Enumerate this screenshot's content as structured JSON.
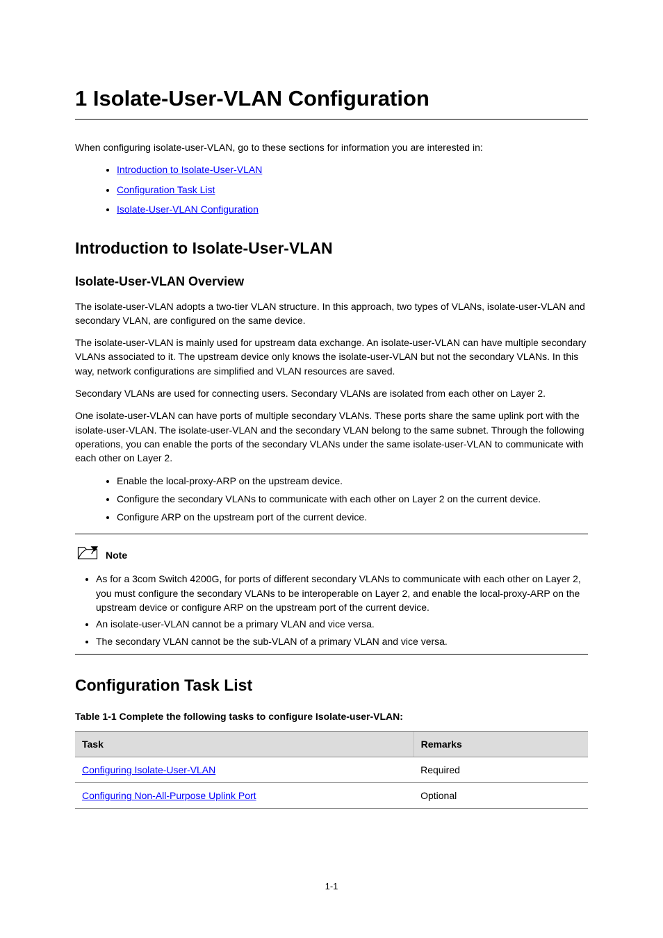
{
  "chapter": {
    "title": "1 Isolate-User-VLAN Configuration"
  },
  "toc": {
    "intro": "When configuring isolate-user-VLAN, go to these sections for information you are interested in:",
    "items": [
      "Introduction to Isolate-User-VLAN",
      "Configuration Task List",
      "Isolate-User-VLAN Configuration"
    ]
  },
  "sections": {
    "intro": {
      "heading": "Introduction to Isolate-User-VLAN",
      "subheading": "Isolate-User-VLAN Overview",
      "p1": "The isolate-user-VLAN adopts a two-tier VLAN structure. In this approach, two types of VLANs, isolate-user-VLAN and secondary VLAN, are configured on the same device.",
      "p2": "The isolate-user-VLAN is mainly used for upstream data exchange. An isolate-user-VLAN can have multiple secondary VLANs associated to it. The upstream device only knows the isolate-user-VLAN but not the secondary VLANs. In this way, network configurations are simplified and VLAN resources are saved.",
      "p3": "Secondary VLANs are used for connecting users. Secondary VLANs are isolated from each other on Layer 2.",
      "p4": "One isolate-user-VLAN can have ports of multiple secondary VLANs. These ports share the same uplink port with the isolate-user-VLAN. The isolate-user-VLAN and the secondary VLAN belong to the same subnet. Through the following operations, you can enable the ports of the secondary VLANs under the same isolate-user-VLAN to communicate with each other on Layer 2.",
      "bullets": [
        "Enable the local-proxy-ARP on the upstream device.",
        "Configure the secondary VLANs to communicate with each other on Layer 2 on the current device.",
        "Configure ARP on the upstream port of the current device."
      ]
    },
    "note": {
      "label": "Note",
      "items": [
        "As for a 3com Switch 4200G, for ports of different secondary VLANs to communicate with each other on Layer 2, you must configure the secondary VLANs to be interoperable on Layer 2, and enable the local-proxy-ARP on the upstream device or configure ARP on the upstream port of the current device.",
        "An isolate-user-VLAN cannot be a primary VLAN and vice versa.",
        "The secondary VLAN cannot be the sub-VLAN of a primary VLAN and vice versa."
      ]
    },
    "tasklist": {
      "heading": "Configuration Task List",
      "caption": "Table 1-1 Complete the following tasks to configure Isolate-user-VLAN:",
      "columns": [
        "Task",
        "Remarks"
      ],
      "rows": [
        {
          "task": "Configuring Isolate-User-VLAN",
          "remarks": "Required"
        },
        {
          "task": "Configuring Non-All-Purpose Uplink Port",
          "remarks": "Optional"
        }
      ]
    }
  },
  "pageNumber": "1-1"
}
